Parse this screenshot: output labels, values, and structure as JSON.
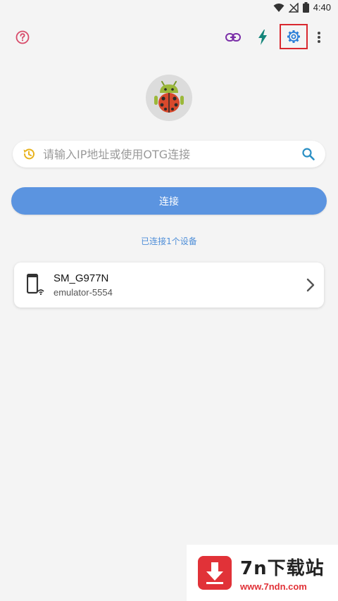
{
  "status_bar": {
    "time": "4:40",
    "icons": [
      "wifi-icon",
      "no-signal-icon",
      "battery-icon"
    ]
  },
  "toolbar": {
    "icons": [
      "help-icon",
      "link-icon",
      "flash-icon",
      "settings-icon",
      "more-vert-icon"
    ],
    "highlight_color": "#d9282f"
  },
  "app_logo": "ladybug-android-logo",
  "search": {
    "placeholder": "请输入IP地址或使用OTG连接",
    "value": ""
  },
  "connect_button": {
    "label": "连接",
    "color": "#5b94e0"
  },
  "connected_info": "已连接1个设备",
  "devices": [
    {
      "name": "SM_G977N",
      "serial": "emulator-5554"
    }
  ],
  "watermark": {
    "title": "7n下载站",
    "url": "www.7ndn.com"
  },
  "colors": {
    "accent_blue": "#5b94e0",
    "link_purple": "#7b2fa8",
    "teal": "#14857a",
    "watermark_red": "#e13238"
  }
}
